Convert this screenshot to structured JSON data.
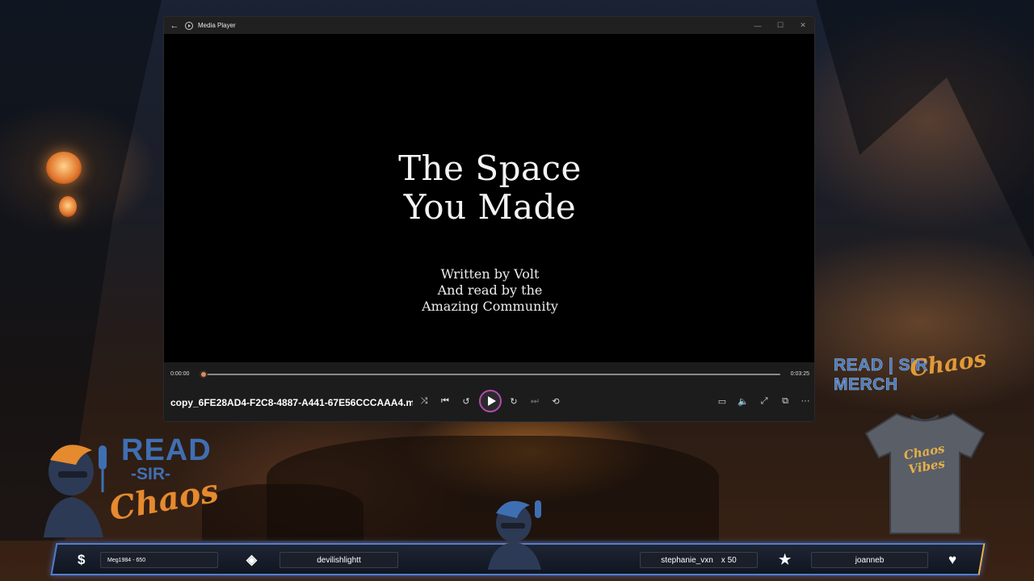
{
  "window": {
    "title": "Media Player",
    "back_glyph": "←",
    "minimize_glyph": "—",
    "maximize_glyph": "☐",
    "close_glyph": "✕"
  },
  "video": {
    "title_line1": "The Space",
    "title_line2": "You Made",
    "credit_line1": "Written by Volt",
    "credit_line2": "And read by the",
    "credit_line3": "Amazing Community"
  },
  "playback": {
    "current_time": "0:00:00",
    "total_time": "0:03:25",
    "progress": 0.0,
    "filename": "copy_6FE28AD4-F2C8-4887-A441-67E56CCCAAA4.m..."
  },
  "controls": {
    "shuffle_glyph": "⤨",
    "previous_glyph": "⏮",
    "rewind_glyph": "↺",
    "forward_glyph": "↻",
    "next_glyph": "⏭",
    "repeat_glyph": "⟲",
    "miniplayer_glyph": "▭",
    "volume_glyph": "🔈",
    "fullscreen_glyph": "⤢",
    "cast_glyph": "⧉",
    "more_glyph": "···"
  },
  "merch": {
    "read_sir": "READ | SIR",
    "chaos": "Chaos",
    "merch": "MERCH"
  },
  "logo": {
    "read": "READ",
    "sir": "-SIR-",
    "chaos": "Chaos"
  },
  "bottom_bar": {
    "donation_icon": "$",
    "donation_text": "Meg1984 - 650",
    "sub_icon": "◈",
    "sub_text": "devilishlightt",
    "gift_text": "stephanie_vxn",
    "gift_count": "x 50",
    "follow_icon": "★",
    "follow_text": "joanneb",
    "heart_icon": "♥"
  },
  "colors": {
    "accent_blue": "#4f7fd2",
    "accent_orange": "#e58a2e",
    "play_ring": "#b44ab0",
    "seek_thumb": "#d98b5f"
  }
}
